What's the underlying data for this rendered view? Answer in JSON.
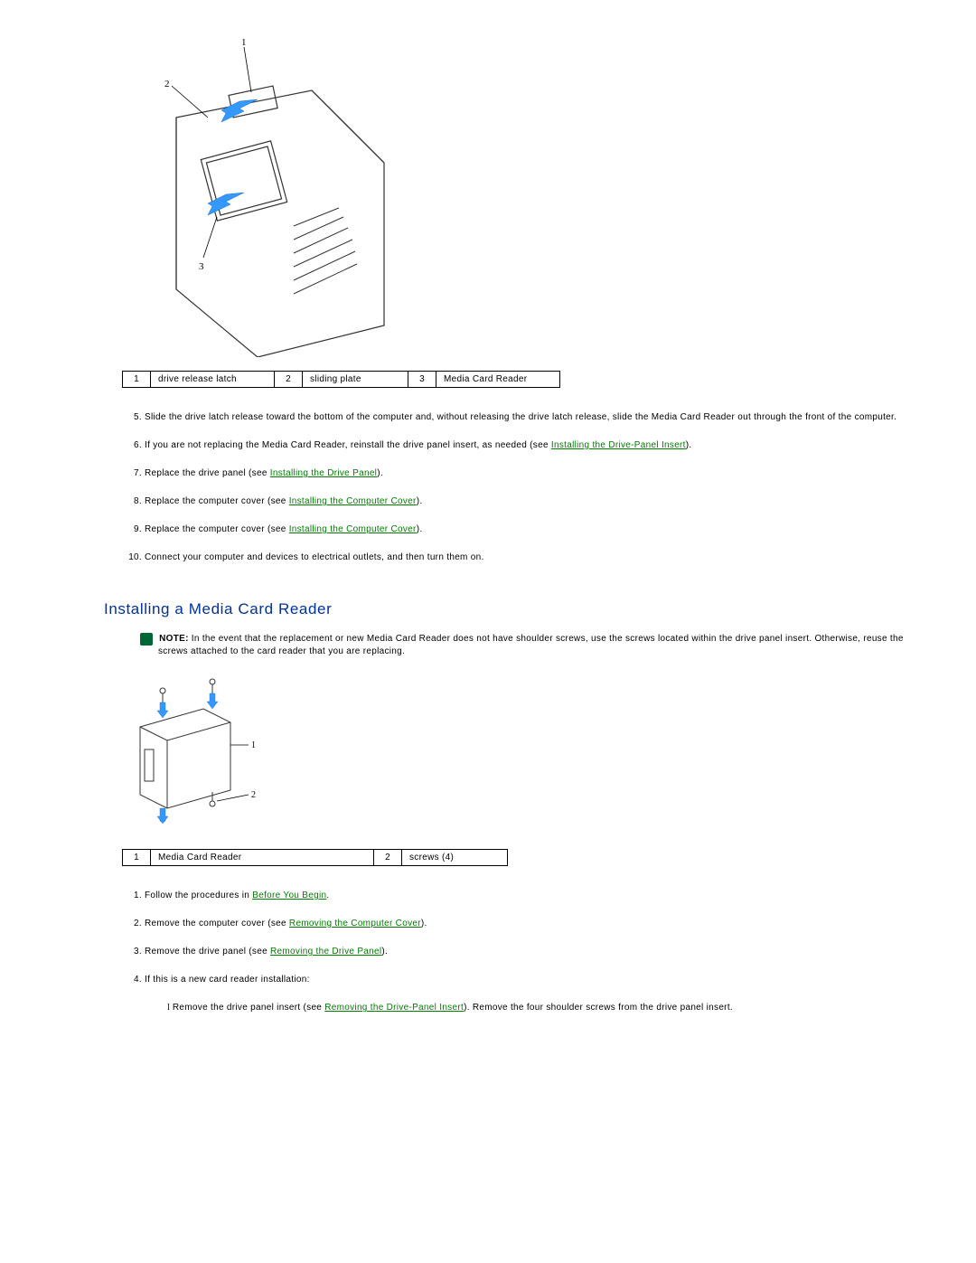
{
  "figure1_table": {
    "cells": [
      "1",
      "drive release latch",
      "2",
      "sliding plate",
      "3",
      "Media Card Reader"
    ]
  },
  "removal_steps": [
    {
      "num": "5.",
      "text": "Slide the drive latch release toward the bottom of the computer and, without releasing the drive latch release, slide the Media Card Reader out through the front of the computer."
    },
    {
      "num": "6.",
      "text_parts": [
        "If you are not replacing the Media Card Reader, reinstall the drive panel insert, as needed (see ",
        {
          "link": "Installing the Drive-Panel Insert"
        },
        ")."
      ]
    },
    {
      "num": "7.",
      "text_parts": [
        "Replace the drive panel (see ",
        {
          "link": "Installing the Drive Panel"
        },
        ")."
      ]
    },
    {
      "num": "8.",
      "text_parts": [
        "Replace the computer cover (see ",
        {
          "link": "Installing the Computer Cover"
        },
        ")."
      ]
    },
    {
      "num": "9.",
      "text_parts": [
        "Replace the computer cover (see ",
        {
          "link": "Installing the Computer Cover"
        },
        ")."
      ]
    },
    {
      "num": "10.",
      "text": "Connect your computer and devices to electrical outlets, and then turn them on."
    }
  ],
  "section_heading": "Installing a Media Card Reader",
  "note": {
    "label": "NOTE:",
    "text": "In the event that the replacement or new Media Card Reader does not have shoulder screws, use the screws located within the drive panel insert. Otherwise, reuse the screws attached to the card reader that you are replacing."
  },
  "figure2_table": {
    "cells": [
      "1",
      "Media Card Reader",
      "2",
      "screws (4)"
    ]
  },
  "install_steps": [
    {
      "num": "1.",
      "text_parts": [
        "Follow the procedures in ",
        {
          "link": "Before You Begin"
        },
        "."
      ]
    },
    {
      "num": "2.",
      "text_parts": [
        "Remove the computer cover (see ",
        {
          "link": "Removing the Computer Cover"
        },
        ")."
      ]
    },
    {
      "num": "3.",
      "text_parts": [
        "Remove the drive panel (see ",
        {
          "link": "Removing the Drive Panel"
        },
        ")."
      ]
    },
    {
      "num": "4.",
      "text": "If this is a new card reader installation:",
      "sub_parts": [
        "Remove the drive panel insert (see ",
        {
          "link": "Removing the Drive-Panel Insert"
        },
        "). Remove the four shoulder screws from the drive panel insert."
      ]
    }
  ],
  "callout_labels": {
    "fig1_1": "1",
    "fig1_2": "2",
    "fig1_3": "3",
    "fig2_1": "1",
    "fig2_2": "2"
  }
}
